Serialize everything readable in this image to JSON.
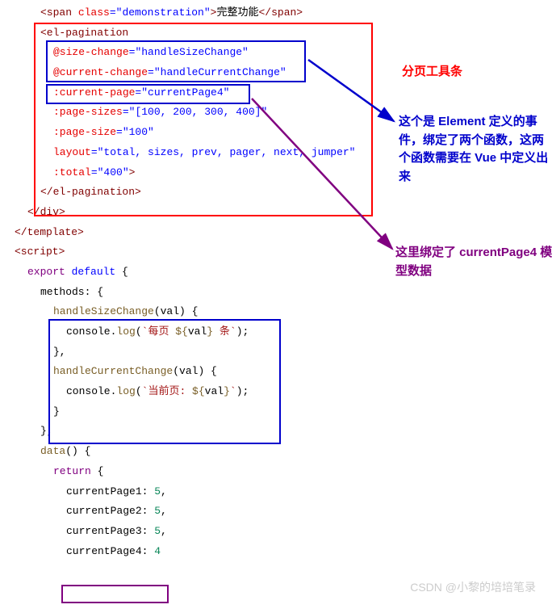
{
  "code": {
    "l1a": "<span",
    "l1b": " class",
    "l1c": "=",
    "l1d": "\"demonstration\"",
    "l1e": ">",
    "l1f": "完整功能",
    "l1g": "</span>",
    "l2a": "<el-pagination",
    "l3a": "@size-change",
    "l3b": "=",
    "l3c": "\"handleSizeChange\"",
    "l4a": "@current-change",
    "l4b": "=",
    "l4c": "\"handleCurrentChange\"",
    "l5a": ":current-page",
    "l5b": "=",
    "l5c": "\"currentPage4\"",
    "l6a": ":page-sizes",
    "l6b": "=",
    "l6c": "\"[100, 200, 300, 400]\"",
    "l7a": ":page-size",
    "l7b": "=",
    "l7c": "\"100\"",
    "l8a": "layout",
    "l8b": "=",
    "l8c": "\"total, sizes, prev, pager, next, jumper\"",
    "l9a": ":total",
    "l9b": "=",
    "l9c": "\"400\"",
    "l9d": ">",
    "l10": "</el-pagination>",
    "l11": "</div>",
    "l12": "</template>",
    "l13": "<script>",
    "l14a": "export",
    "l14b": " default",
    "l14c": " {",
    "l15a": "methods",
    "l15b": ": {",
    "l16a": "handleSizeChange",
    "l16b": "(val) {",
    "l17a": "console",
    "l17b": ".",
    "l17c": "log",
    "l17d": "(",
    "l17e": "`每页 ",
    "l17f": "${",
    "l17g": "val",
    "l17h": "}",
    "l17i": " 条`",
    "l17j": ");",
    "l18": "},",
    "l19a": "handleCurrentChange",
    "l19b": "(val) {",
    "l20a": "console",
    "l20b": ".",
    "l20c": "log",
    "l20d": "(",
    "l20e": "`当前页: ",
    "l20f": "${",
    "l20g": "val",
    "l20h": "}",
    "l20i": "`",
    "l20j": ");",
    "l21": "}",
    "l22": "},",
    "l23a": "data",
    "l23b": "() {",
    "l24a": "return",
    "l24b": " {",
    "l25a": "currentPage1",
    "l25b": ": ",
    "l25c": "5",
    "l25d": ",",
    "l26a": "currentPage2",
    "l26b": ": ",
    "l26c": "5",
    "l26d": ",",
    "l27a": "currentPage3",
    "l27b": ": ",
    "l27c": "5",
    "l27d": ",",
    "l28a": "currentPage4",
    "l28b": ": ",
    "l28c": "4"
  },
  "annotations": {
    "title": "分页工具条",
    "blue1": "这个是 Element 定义的事件，绑定了两个函数，这两个函数需要在 Vue 中定义出来",
    "purple1": "这里绑定了 currentPage4 模型数据"
  },
  "watermark": "CSDN @小黎的培培笔录"
}
